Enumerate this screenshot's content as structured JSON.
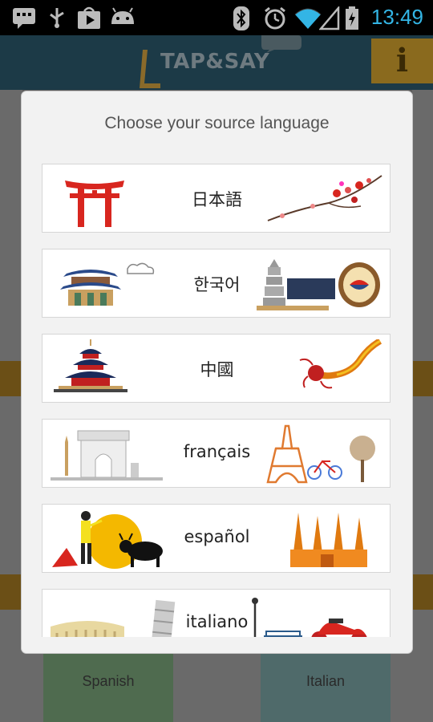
{
  "status_bar": {
    "time": "13:49",
    "icons": [
      "message-icon",
      "usb-icon",
      "play-store-icon",
      "android-icon",
      "bluetooth-icon",
      "alarm-icon",
      "wifi-icon",
      "signal-icon",
      "battery-icon"
    ]
  },
  "app": {
    "title": "TAP&SAY",
    "info_label": "i",
    "bottom_tiles": [
      "Spanish",
      "Italian"
    ]
  },
  "dialog": {
    "title": "Choose your source language",
    "languages": [
      {
        "label": "日本語"
      },
      {
        "label": "한국어"
      },
      {
        "label": "中國"
      },
      {
        "label": "français"
      },
      {
        "label": "español"
      },
      {
        "label": "italiano"
      }
    ]
  },
  "colors": {
    "accent_time": "#33b5e5",
    "dialog_bg": "#f2f2f2",
    "appbar": "#1c3a47"
  }
}
